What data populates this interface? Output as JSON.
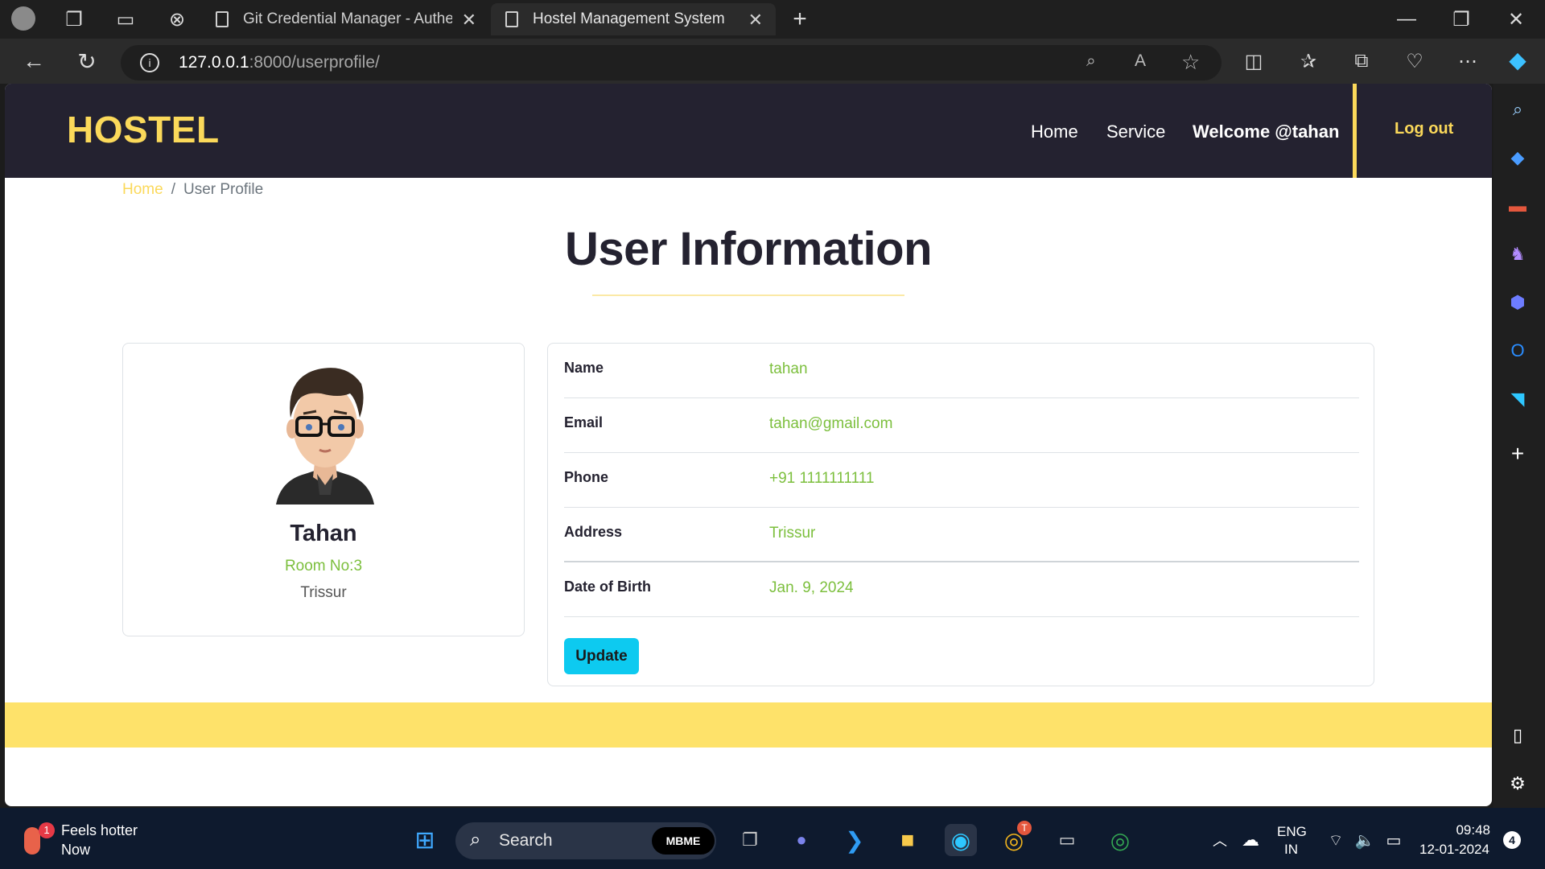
{
  "browser": {
    "tabs": [
      {
        "label": "Git Credential Manager - Authen",
        "active": false
      },
      {
        "label": "Hostel Management System",
        "active": true
      }
    ],
    "url_host": "127.0.0.1",
    "url_rest": ":8000/userprofile/"
  },
  "navbar": {
    "brand": "HOSTEL",
    "links": [
      "Home",
      "Service",
      "Welcome @tahan"
    ],
    "logout": "Log out"
  },
  "breadcrumb": {
    "home": "Home",
    "separator": "/",
    "current": "User Profile"
  },
  "page_title": "User Information",
  "profile": {
    "name": "Tahan",
    "room": "Room No:3",
    "city": "Trissur"
  },
  "info": {
    "rows": [
      {
        "label": "Name",
        "value": "tahan"
      },
      {
        "label": "Email",
        "value": "tahan@gmail.com"
      },
      {
        "label": "Phone",
        "value": "+91 1111111111"
      },
      {
        "label": "Address",
        "value": "Trissur"
      },
      {
        "label": "Date of Birth",
        "value": "Jan. 9, 2024"
      }
    ],
    "update_label": "Update"
  },
  "taskbar": {
    "weather_title": "Feels hotter",
    "weather_sub": "Now",
    "weather_badge": "1",
    "search_label": "Search",
    "mbme": "MBME",
    "lang_line1": "ENG",
    "lang_line2": "IN",
    "time": "09:48",
    "date": "12-01-2024",
    "notifications": "4",
    "chrome_badge": "T"
  },
  "colors": {
    "accent": "#fbd95a",
    "nav_bg": "#242230",
    "value_green": "#7cbf3d",
    "button_cyan": "#0dcaf0",
    "footer": "#fee26a"
  }
}
